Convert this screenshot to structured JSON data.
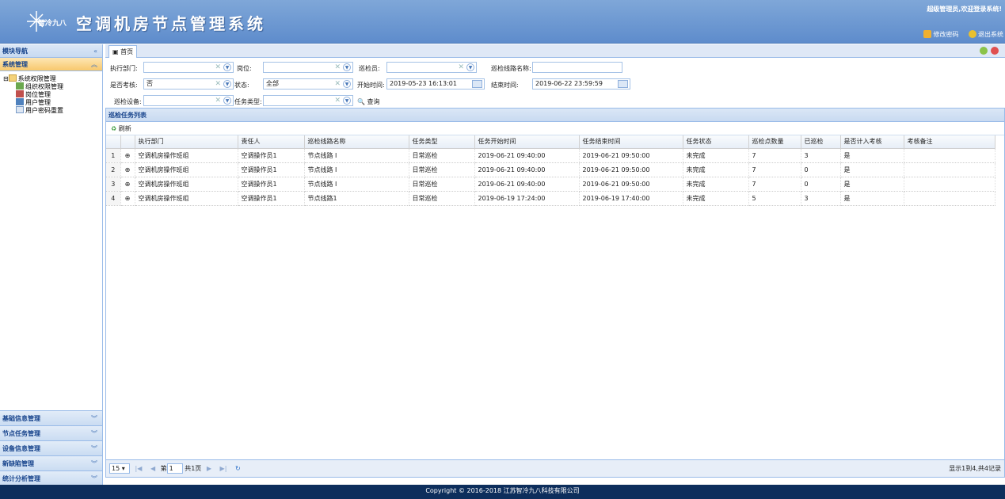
{
  "header": {
    "logo_text": "智冷九八",
    "title": "空调机房节点管理系统",
    "welcome": "超级管理员,欢迎登录系统!",
    "change_password": "修改密码",
    "logout": "退出系统"
  },
  "sidebar": {
    "title": "模块导航",
    "collapse_icon": "«",
    "active_section": "系统管理",
    "tree": {
      "root": "系统权限管理",
      "children": [
        "组织权限管理",
        "岗位管理",
        "用户管理",
        "用户密码重置"
      ]
    },
    "sections": [
      "基础信息管理",
      "节点任务管理",
      "设备信息管理",
      "新缺陷管理",
      "统计分析管理"
    ]
  },
  "tab": {
    "home": "首页"
  },
  "form": {
    "dept_label": "执行部门:",
    "post_label": "岗位:",
    "inspector_label": "巡检员:",
    "route_label": "巡检线路名称:",
    "assess_label": "是否考核:",
    "assess_value": "否",
    "status_label": "状态:",
    "status_value": "全部",
    "start_label": "开始时间:",
    "start_value": "2019-05-23 16:13:01",
    "end_label": "结束时间:",
    "end_value": "2019-06-22 23:59:59",
    "device_label": "巡检设备:",
    "tasktype_label": "任务类型:",
    "query": "查询"
  },
  "grid": {
    "title": "巡检任务列表",
    "refresh": "刷新",
    "columns": [
      "执行部门",
      "责任人",
      "巡检线路名称",
      "任务类型",
      "任务开始时间",
      "任务结束时间",
      "任务状态",
      "巡检点数量",
      "已巡检",
      "是否计入考核",
      "考核备注"
    ],
    "rows": [
      {
        "n": "1",
        "dept": "空调机房操作班组",
        "person": "空调操作员1",
        "route": "节点线路 I",
        "type": "日常巡检",
        "start": "2019-06-21 09:40:00",
        "end": "2019-06-21 09:50:00",
        "status": "未完成",
        "points": "7",
        "done": "3",
        "assess": "是",
        "note": ""
      },
      {
        "n": "2",
        "dept": "空调机房操作班组",
        "person": "空调操作员1",
        "route": "节点线路 I",
        "type": "日常巡检",
        "start": "2019-06-21 09:40:00",
        "end": "2019-06-21 09:50:00",
        "status": "未完成",
        "points": "7",
        "done": "0",
        "assess": "是",
        "note": ""
      },
      {
        "n": "3",
        "dept": "空调机房操作班组",
        "person": "空调操作员1",
        "route": "节点线路 I",
        "type": "日常巡检",
        "start": "2019-06-21 09:40:00",
        "end": "2019-06-21 09:50:00",
        "status": "未完成",
        "points": "7",
        "done": "0",
        "assess": "是",
        "note": ""
      },
      {
        "n": "4",
        "dept": "空调机房操作班组",
        "person": "空调操作员1",
        "route": "节点线路1",
        "type": "日常巡检",
        "start": "2019-06-19 17:24:00",
        "end": "2019-06-19 17:40:00",
        "status": "未完成",
        "points": "5",
        "done": "3",
        "assess": "是",
        "note": ""
      }
    ]
  },
  "pager": {
    "page_size": "15",
    "page_prefix": "第",
    "page": "1",
    "page_total": "共1页",
    "info": "显示1到4,共4记录"
  },
  "footer": "Copyright © 2016-2018 江苏智冷九八科技有限公司"
}
